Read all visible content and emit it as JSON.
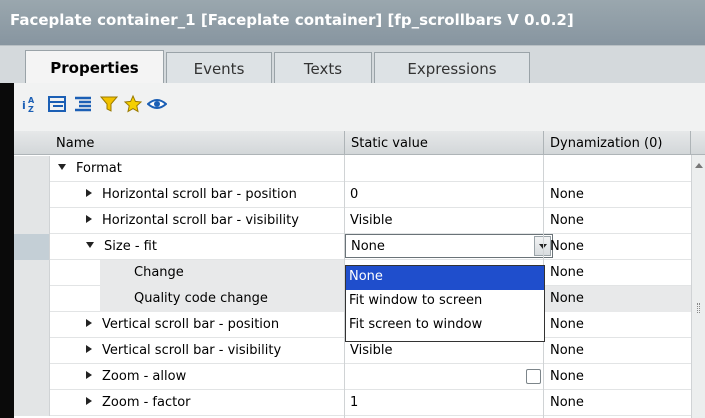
{
  "window": {
    "title": "Faceplate container_1 [Faceplate container] [fp_scrollbars V 0.0.2]"
  },
  "tabs": [
    {
      "label": "Properties",
      "active": true
    },
    {
      "label": "Events",
      "active": false
    },
    {
      "label": "Texts",
      "active": false
    },
    {
      "label": "Expressions",
      "active": false
    }
  ],
  "toolbar": {
    "icons": [
      "sort-az-icon",
      "expand-tree-icon",
      "collapse-tree-icon",
      "filter-icon",
      "favorites-star-icon",
      "eye-icon"
    ]
  },
  "grid": {
    "headers": {
      "name": "Name",
      "static": "Static value",
      "dyn": "Dynamization (0)"
    },
    "rows": [
      {
        "name": "Format",
        "value": "",
        "dyn": ""
      },
      {
        "name": "Horizontal scroll bar - position",
        "value": "0",
        "dyn": "None"
      },
      {
        "name": "Horizontal scroll bar - visibility",
        "value": "Visible",
        "dyn": "None"
      },
      {
        "name": "Size - fit",
        "value": "None",
        "dyn": "None"
      },
      {
        "name": "Change",
        "value": "",
        "dyn": "None"
      },
      {
        "name": "Quality code change",
        "value": "",
        "dyn": "None"
      },
      {
        "name": "Vertical scroll bar - position",
        "value": "",
        "dyn": "None"
      },
      {
        "name": "Vertical scroll bar - visibility",
        "value": "Visible",
        "dyn": "None"
      },
      {
        "name": "Zoom - allow",
        "value": "",
        "dyn": "None"
      },
      {
        "name": "Zoom - factor",
        "value": "1",
        "dyn": "None"
      }
    ]
  },
  "dropdown": {
    "options": [
      "None",
      "Fit window to screen",
      "Fit screen to window"
    ],
    "selected": "None"
  }
}
